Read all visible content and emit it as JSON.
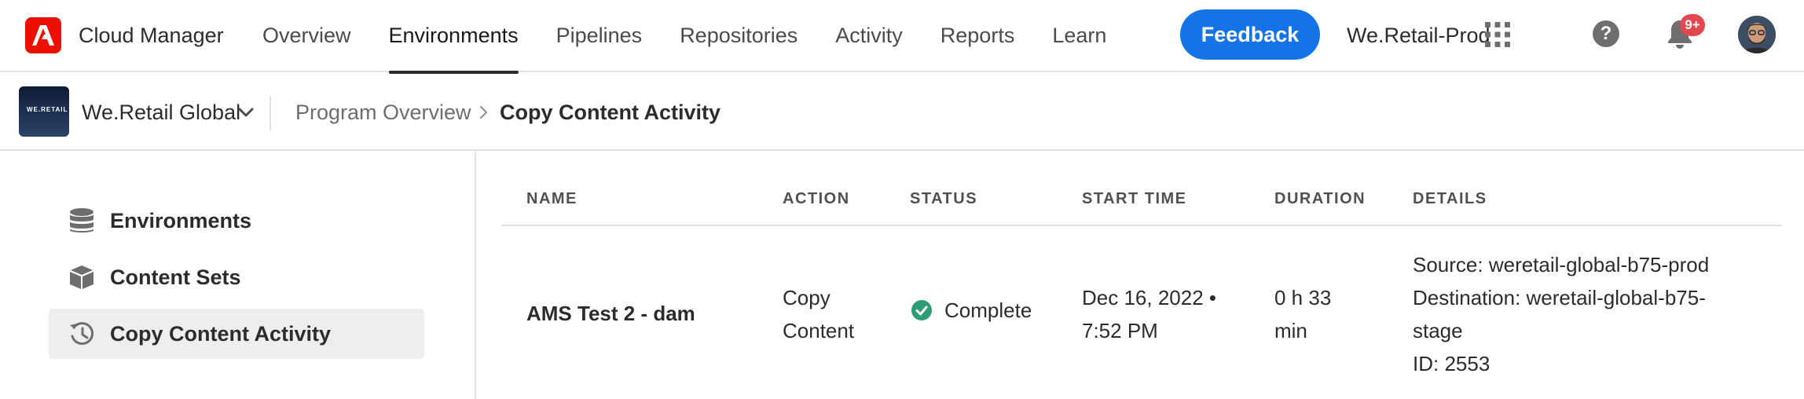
{
  "header": {
    "app_name": "Cloud Manager",
    "nav": [
      "Overview",
      "Environments",
      "Pipelines",
      "Repositories",
      "Activity",
      "Reports",
      "Learn"
    ],
    "active_nav": "Environments",
    "feedback_label": "Feedback",
    "org_name": "We.Retail-Prod",
    "notification_count": "9+",
    "icons": [
      "adobe-logo",
      "apps-grid-icon",
      "help-icon",
      "bell-icon",
      "avatar"
    ]
  },
  "subbar": {
    "program_name": "We.Retail Global",
    "program_thumb_text": "WE.RETAIL",
    "breadcrumb": {
      "parent": "Program Overview",
      "current": "Copy Content Activity"
    }
  },
  "sidebar": {
    "items": [
      {
        "label": "Environments",
        "icon": "database-icon",
        "active": false
      },
      {
        "label": "Content Sets",
        "icon": "box-icon",
        "active": false
      },
      {
        "label": "Copy Content Activity",
        "icon": "history-icon",
        "active": true
      }
    ]
  },
  "table": {
    "headers": [
      "NAME",
      "ACTION",
      "STATUS",
      "START TIME",
      "DURATION",
      "DETAILS"
    ],
    "rows": [
      {
        "name": "AMS Test 2 - dam",
        "action_line1": "Copy",
        "action_line2": "Content",
        "status": "Complete",
        "start_line1": "Dec 16, 2022 •",
        "start_line2": "7:52 PM",
        "duration_line1": "0 h 33",
        "duration_line2": "min",
        "details_line1": "Source: weretail-global-b75-prod",
        "details_line2": "Destination: weretail-global-b75-",
        "details_line3": "stage",
        "details_line4": "ID: 2553"
      }
    ]
  },
  "colors": {
    "adobe_red": "#eb1000",
    "accent_blue": "#1473e6",
    "success_green": "#2d9d78",
    "badge_red": "#e34850"
  }
}
